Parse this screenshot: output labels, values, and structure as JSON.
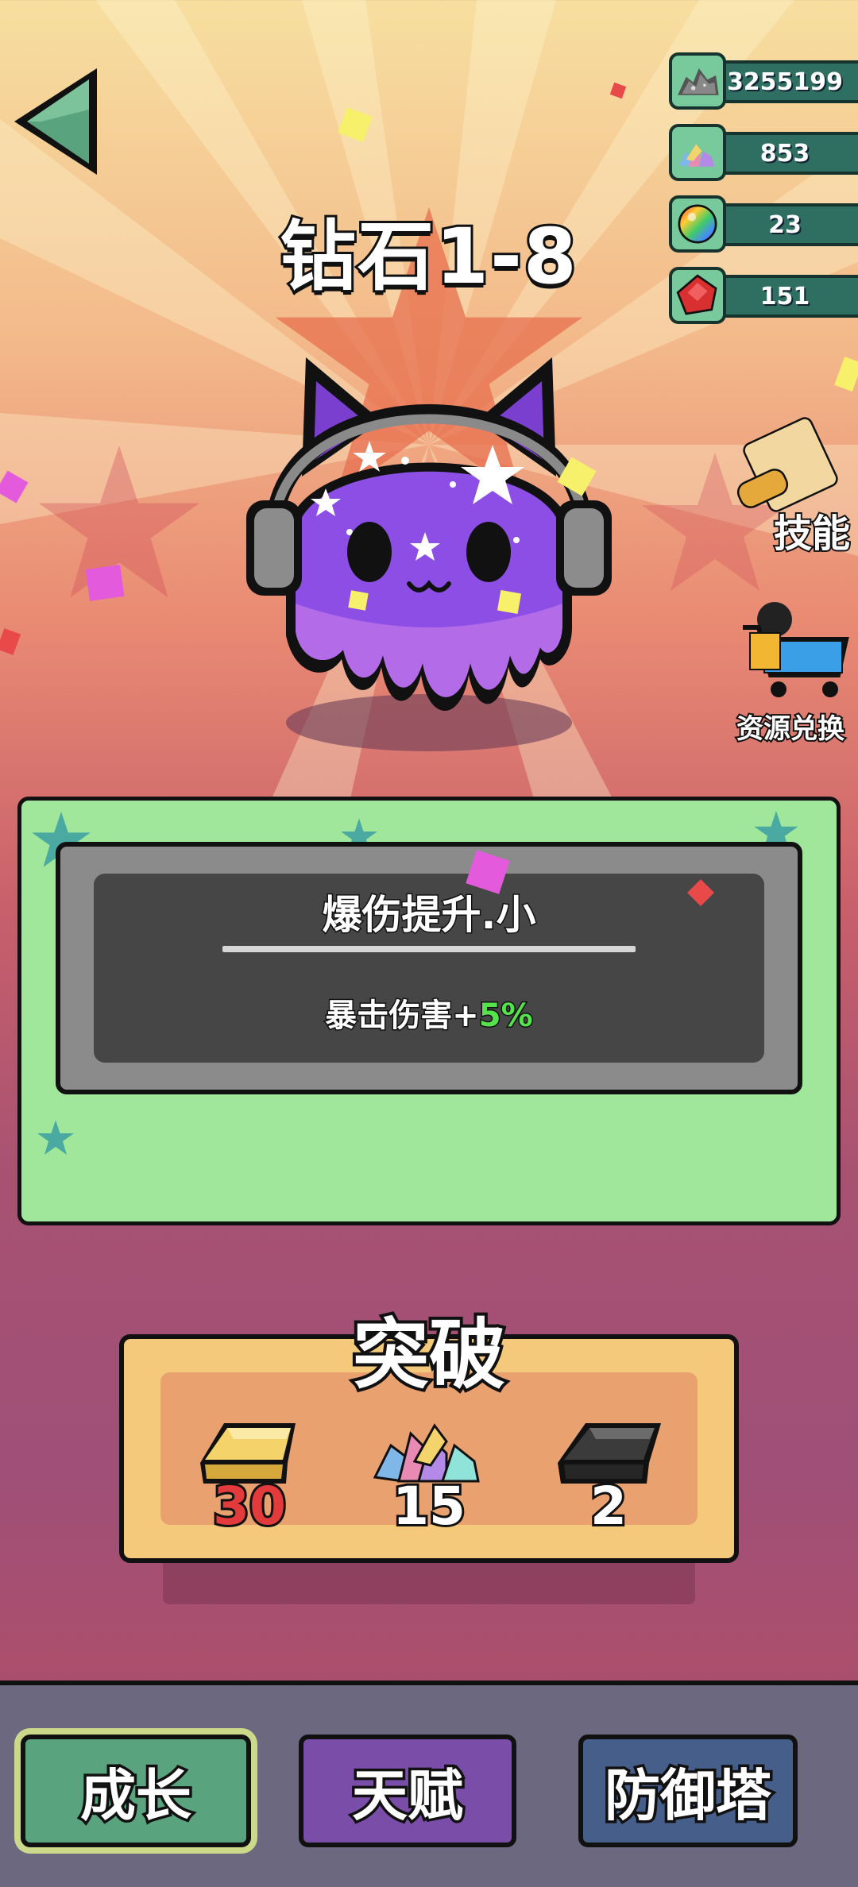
{
  "header": {
    "title": "钻石1-8"
  },
  "resources": [
    {
      "name": "silver-ore",
      "icon": "ore-pile-icon",
      "value": "3255199"
    },
    {
      "name": "crystals",
      "icon": "crystal-pile-icon",
      "value": "853"
    },
    {
      "name": "rainbow-orb",
      "icon": "rainbow-orb-icon",
      "value": "23"
    },
    {
      "name": "red-gem",
      "icon": "red-gem-icon",
      "value": "151"
    }
  ],
  "side_buttons": {
    "skills_label": "技能",
    "exchange_label": "资源兑换"
  },
  "skill_panel": {
    "name": "爆伤提升.小",
    "desc_prefix": "暴击伤害+",
    "desc_value": "5%"
  },
  "breakthrough": {
    "title": "突破",
    "costs": [
      {
        "item": "gold-bar-icon",
        "amount": "30",
        "insufficient": true
      },
      {
        "item": "crystal-pile-icon",
        "amount": "15",
        "insufficient": false
      },
      {
        "item": "black-ingot-icon",
        "amount": "2",
        "insufficient": false
      }
    ]
  },
  "bottom_nav": {
    "tabs": [
      {
        "label": "成长",
        "active": true
      },
      {
        "label": "天赋",
        "active": false
      },
      {
        "label": "防御塔",
        "active": false
      }
    ]
  },
  "colors": {
    "accent_green": "#55e24c",
    "panel_green": "#a0e69b",
    "insufficient_red": "#e33b3b"
  }
}
